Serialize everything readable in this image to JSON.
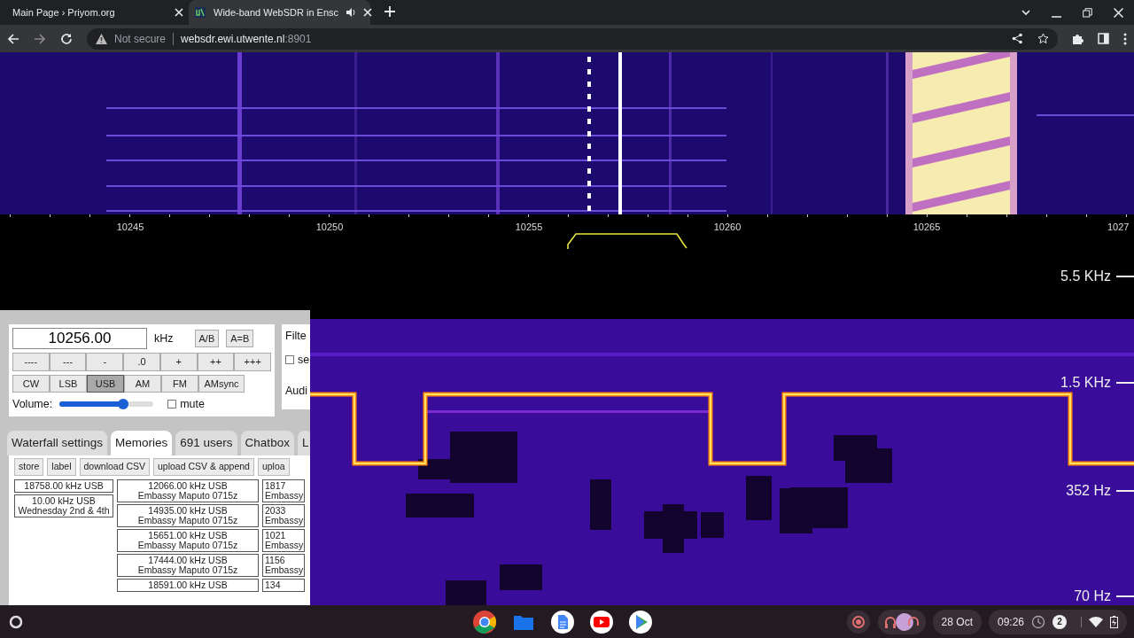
{
  "browser": {
    "tabs": [
      {
        "title": "Main Page › Priyom.org",
        "selected": false,
        "audio": false
      },
      {
        "title": "Wide-band WebSDR in Ensc",
        "selected": true,
        "audio": true
      }
    ],
    "address": {
      "security": "Not secure",
      "host": "websdr.ewi.utwente.nl",
      "port": ":8901"
    }
  },
  "scale": {
    "labels": [
      "10245",
      "10250",
      "10255",
      "10260",
      "10265",
      "1027"
    ]
  },
  "spectrogram": {
    "axis_labels": [
      "5.5 KHz",
      "1.5 KHz",
      "352 Hz",
      "70 Hz"
    ]
  },
  "tuning": {
    "frequency": "10256.00",
    "unit": "kHz",
    "vfo_buttons": [
      "A/B",
      "A=B"
    ],
    "step_buttons": [
      "----",
      "---",
      "-",
      ".0",
      "+",
      "++",
      "+++"
    ],
    "modes": [
      {
        "label": "CW",
        "selected": false
      },
      {
        "label": "LSB",
        "selected": false
      },
      {
        "label": "USB",
        "selected": true
      },
      {
        "label": "AM",
        "selected": false
      },
      {
        "label": "FM",
        "selected": false
      },
      {
        "label": "AMsync",
        "selected": false
      }
    ],
    "volume": {
      "label": "Volume:",
      "level": 0.68
    },
    "mute": {
      "label": "mute",
      "checked": false
    }
  },
  "side_box": {
    "title": "Filte",
    "checkbox": {
      "label": "se",
      "checked": false
    },
    "audio_label": "Audi"
  },
  "panel_tabs": [
    {
      "label": "Waterfall settings",
      "selected": false
    },
    {
      "label": "Memories",
      "selected": true
    },
    {
      "label": "691 users",
      "selected": false
    },
    {
      "label": "Chatbox",
      "selected": false
    },
    {
      "label": "L",
      "selected": false
    }
  ],
  "memory_buttons": [
    "store",
    "label",
    "download CSV",
    "upload CSV & append",
    "uploa"
  ],
  "memory_columns": [
    [
      {
        "lines": [
          "18758.00 kHz USB"
        ]
      },
      {
        "lines": [
          "10.00 kHz USB",
          "Wednesday 2nd & 4th"
        ]
      }
    ],
    [
      {
        "lines": [
          "12066.00 kHz USB",
          "Embassy Maputo 0715z"
        ]
      },
      {
        "lines": [
          "14935.00 kHz USB",
          "Embassy Maputo 0715z"
        ]
      },
      {
        "lines": [
          "15651.00 kHz USB",
          "Embassy Maputo 0715z"
        ]
      },
      {
        "lines": [
          "17444.00 kHz USB",
          "Embassy Maputo 0715z"
        ]
      },
      {
        "lines": [
          "18591.00 kHz USB"
        ]
      }
    ],
    [
      {
        "lines": [
          "1817",
          "Embassy"
        ]
      },
      {
        "lines": [
          "2033",
          "Embassy"
        ]
      },
      {
        "lines": [
          "1021",
          "Embassy"
        ]
      },
      {
        "lines": [
          "1156",
          "Embassy"
        ]
      },
      {
        "lines": [
          "134"
        ]
      }
    ]
  ],
  "taskbar": {
    "date": "28 Oct",
    "time": "09:26",
    "notifications": "2"
  }
}
